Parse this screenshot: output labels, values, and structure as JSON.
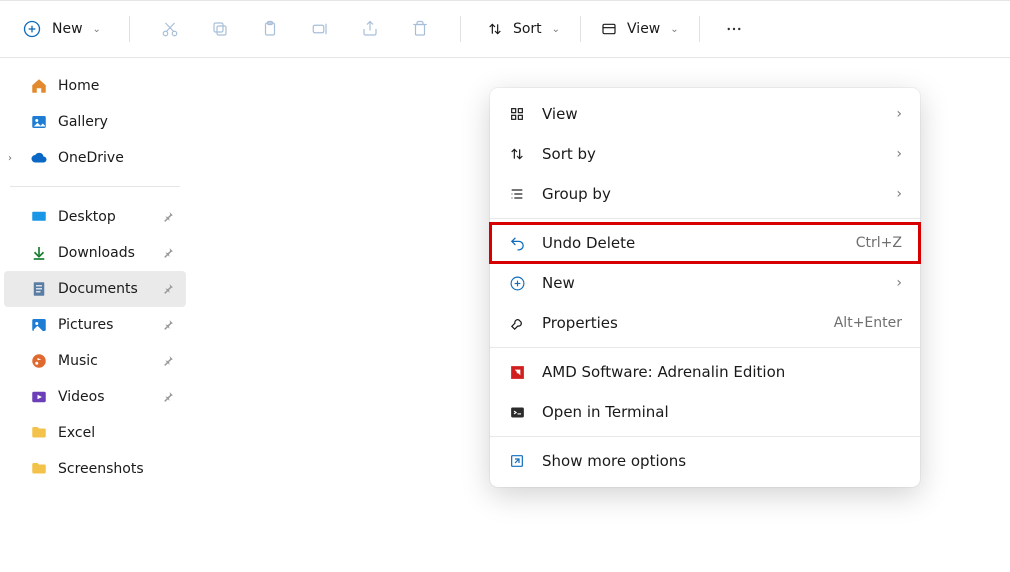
{
  "toolbar": {
    "new_label": "New",
    "sort_label": "Sort",
    "view_label": "View"
  },
  "sidebar": {
    "home": "Home",
    "gallery": "Gallery",
    "onedrive": "OneDrive",
    "desktop": "Desktop",
    "downloads": "Downloads",
    "documents": "Documents",
    "pictures": "Pictures",
    "music": "Music",
    "videos": "Videos",
    "excel": "Excel",
    "screenshots": "Screenshots"
  },
  "context_menu": {
    "view": {
      "label": "View"
    },
    "sort_by": {
      "label": "Sort by"
    },
    "group_by": {
      "label": "Group by"
    },
    "undo_delete": {
      "label": "Undo Delete",
      "shortcut": "Ctrl+Z"
    },
    "new": {
      "label": "New"
    },
    "properties": {
      "label": "Properties",
      "shortcut": "Alt+Enter"
    },
    "amd": {
      "label": "AMD Software: Adrenalin Edition"
    },
    "terminal": {
      "label": "Open in Terminal"
    },
    "more": {
      "label": "Show more options"
    }
  }
}
